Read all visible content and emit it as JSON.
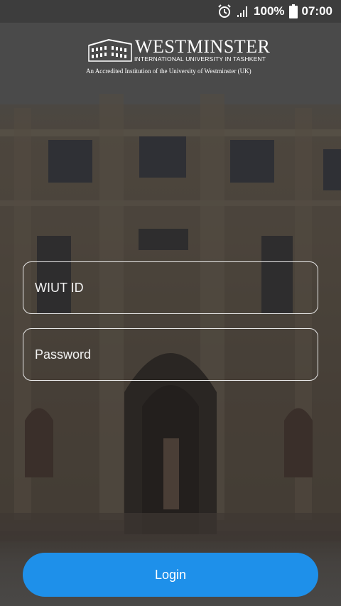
{
  "status_bar": {
    "battery_percent": "100%",
    "time": "07:00",
    "icons": [
      "alarm-icon",
      "signal-icon",
      "battery-icon"
    ]
  },
  "logo": {
    "title": "WESTMINSTER",
    "subtitle": "INTERNATIONAL UNIVERSITY IN TASHKENT",
    "accreditation": "An Accredited Institution of the University of Westminster (UK)"
  },
  "form": {
    "id_placeholder": "WIUT ID",
    "password_placeholder": "Password",
    "login_label": "Login"
  },
  "colors": {
    "accent": "#1e90ea",
    "status_bar": "#3d3d3d",
    "field_border": "#e9e9e9"
  }
}
